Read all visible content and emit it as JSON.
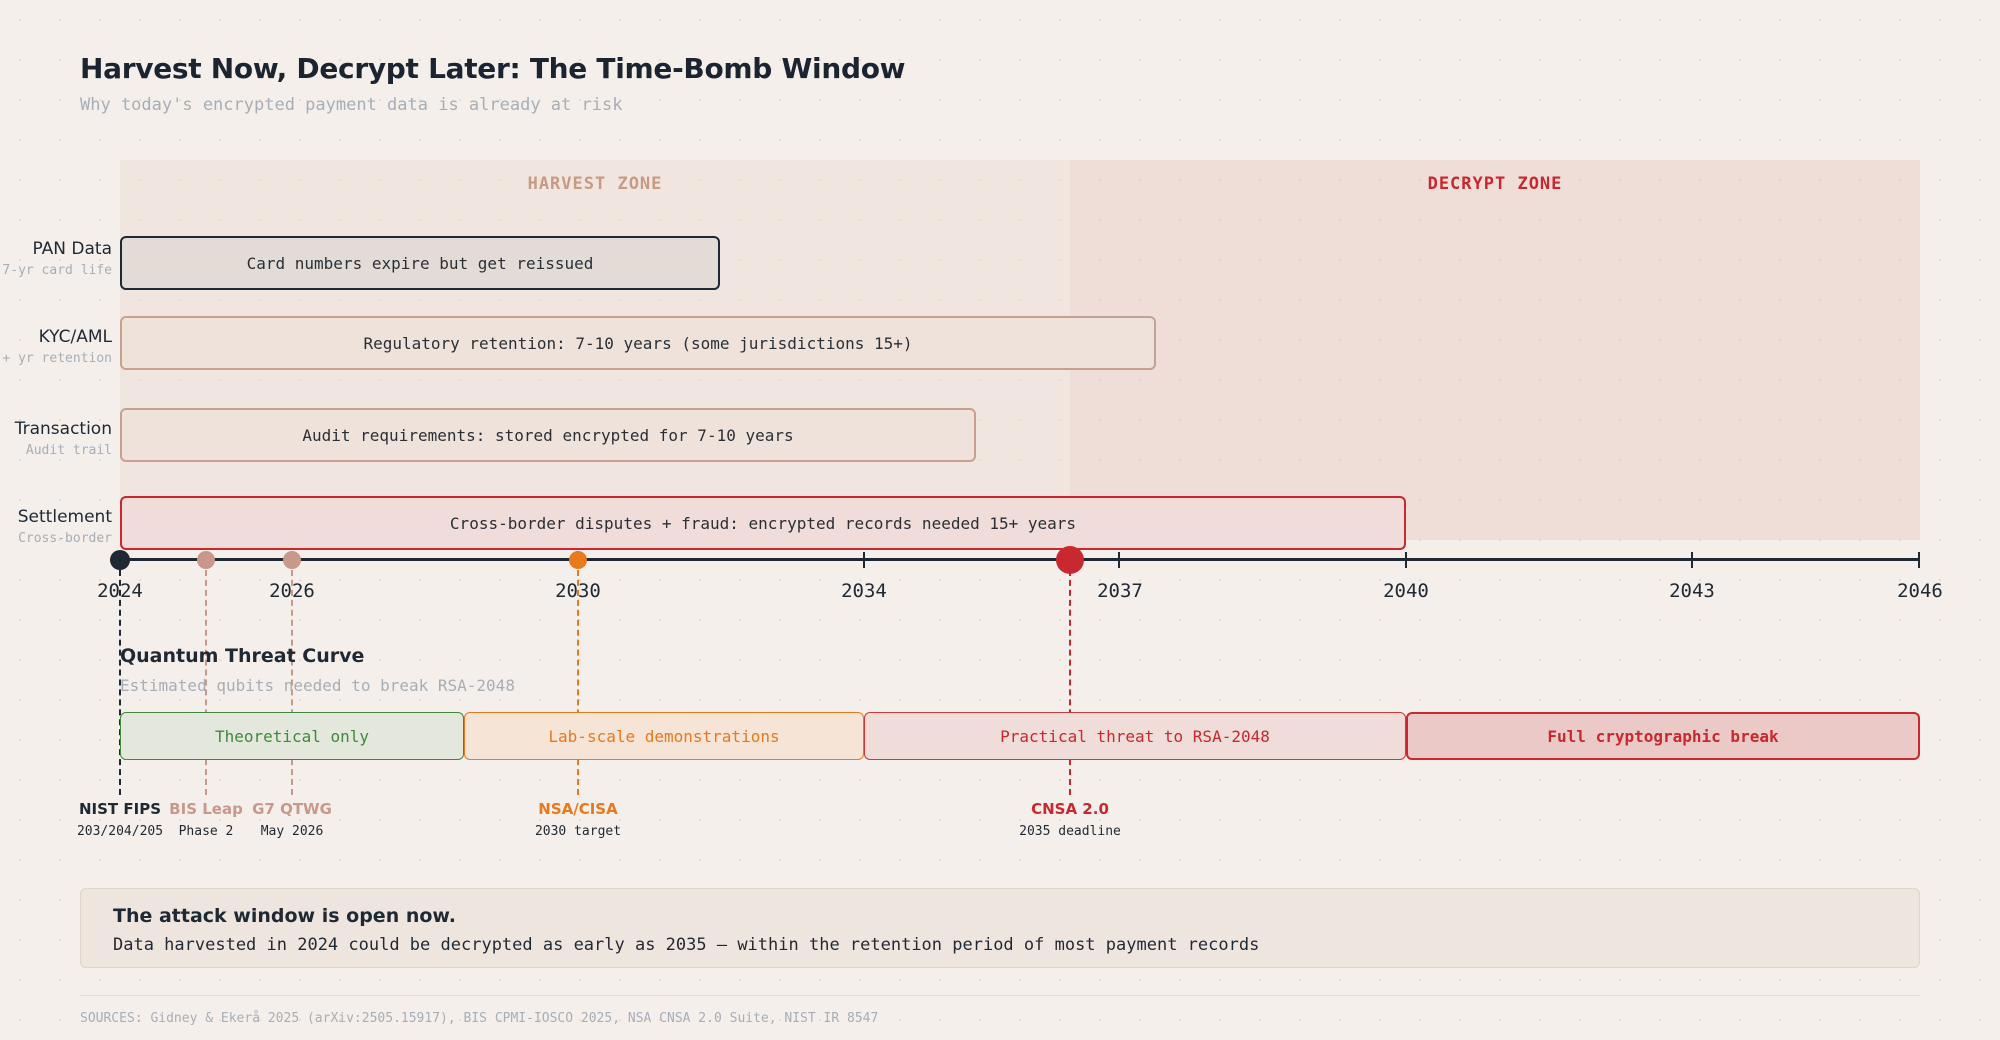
{
  "header": {
    "title": "Harvest Now, Decrypt Later: The Time-Bomb Window",
    "subtitle": "Why today's encrypted payment data is already at risk"
  },
  "zones": {
    "harvest_label": "HARVEST ZONE",
    "decrypt_label": "DECRYPT ZONE"
  },
  "rows": [
    {
      "label": "PAN Data",
      "sub": "7-yr card life",
      "bar": "Card numbers expire but get reissued",
      "end_year": 2030.7
    },
    {
      "label": "KYC/AML",
      "sub": "+ yr retention",
      "bar": "Regulatory retention: 7-10 years (some jurisdictions 15+)",
      "end_year": 2037.5
    },
    {
      "label": "Transaction",
      "sub": "Audit trail",
      "bar": "Audit requirements: stored encrypted for 7-10 years",
      "end_year": 2034.0
    },
    {
      "label": "Settlement",
      "sub": "Cross-border",
      "bar": "Cross-border disputes + fraud: encrypted records needed 15+ years",
      "end_year": 2040.0
    }
  ],
  "axis": {
    "ticks": [
      "2024",
      "2026",
      "2030",
      "2034",
      "2037",
      "2040",
      "2043",
      "2046"
    ]
  },
  "quantum": {
    "title": "Quantum Threat Curve",
    "subtitle": "Estimated qubits needed to break RSA-2048",
    "phases": [
      "Theoretical only",
      "Lab-scale demonstrations",
      "Practical threat to RSA-2048",
      "Full cryptographic break"
    ]
  },
  "milestones": [
    {
      "name": "NIST FIPS",
      "detail": "203/204/205",
      "color": "#1f2933"
    },
    {
      "name": "BIS Leap",
      "detail": "Phase 2",
      "color": "#c8998a"
    },
    {
      "name": "G7 QTWG",
      "detail": "May 2026",
      "color": "#c8998a"
    },
    {
      "name": "NSA/CISA",
      "detail": "2030 target",
      "color": "#e8791c"
    },
    {
      "name": "CNSA 2.0",
      "detail": "2035 deadline",
      "color": "#c8282e"
    }
  ],
  "callout": {
    "heading": "The attack window is open now.",
    "body": "Data harvested in 2024 could be decrypted as early as 2035 — within the retention period of most payment records"
  },
  "sources": "SOURCES: Gidney & Ekerå 2025 (arXiv:2505.15917), BIS CPMI-IOSCO 2025, NSA CNSA 2.0 Suite, NIST IR 8547"
}
